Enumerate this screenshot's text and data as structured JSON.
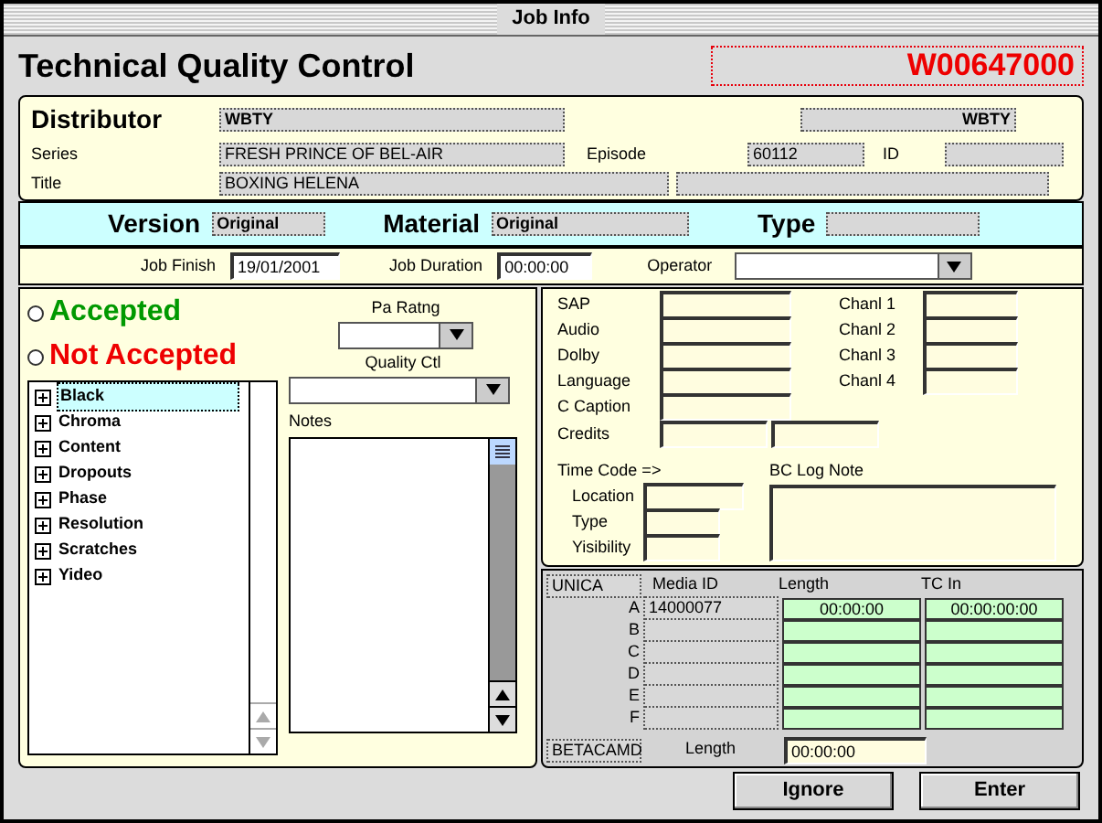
{
  "window": {
    "title": "Job Info"
  },
  "header": {
    "heading": "Technical Quality Control",
    "job_number": "W00647000"
  },
  "distributor": {
    "label": "Distributor",
    "value": "WBTY",
    "value_2": "WBTY"
  },
  "series": {
    "label": "Series",
    "value": "FRESH PRINCE OF BEL-AIR"
  },
  "episode": {
    "label": "Episode",
    "value": "60112"
  },
  "id": {
    "label": "ID"
  },
  "title_row": {
    "label": "Title",
    "value": "BOXING HELENA"
  },
  "version": {
    "label": "Version",
    "value": "Original"
  },
  "material": {
    "label": "Material",
    "value": "Original"
  },
  "type": {
    "label": "Type"
  },
  "job_finish": {
    "label": "Job Finish",
    "value": "19/01/2001"
  },
  "job_duration": {
    "label": "Job Duration",
    "value": "00:00:00"
  },
  "operator": {
    "label": "Operator"
  },
  "acceptance": [
    {
      "label": "Accepted",
      "selected": false,
      "color": "#009900"
    },
    {
      "label": "Not Accepted",
      "selected": false,
      "color": "#ee0000"
    }
  ],
  "pa_rating": {
    "label": "Pa Ratng"
  },
  "quality_ctl": {
    "label": "Quality Ctl"
  },
  "notes": {
    "label": "Notes"
  },
  "tree": [
    {
      "label": "Black",
      "selected": true,
      "expanded": false
    },
    {
      "label": "Chroma",
      "selected": false,
      "expanded": false
    },
    {
      "label": "Content",
      "selected": false,
      "expanded": false
    },
    {
      "label": "Dropouts",
      "selected": false,
      "expanded": false
    },
    {
      "label": "Phase",
      "selected": false,
      "expanded": false
    },
    {
      "label": "Resolution",
      "selected": false,
      "expanded": false
    },
    {
      "label": "Scratches",
      "selected": false,
      "expanded": false
    },
    {
      "label": "Yideo",
      "selected": false,
      "expanded": false
    }
  ],
  "audio_fields": [
    {
      "label": "SAP"
    },
    {
      "label": "Audio"
    },
    {
      "label": "Dolby"
    },
    {
      "label": "Language"
    },
    {
      "label": "C Caption"
    }
  ],
  "channels": [
    {
      "label": "Chanl 1"
    },
    {
      "label": "Chanl 2"
    },
    {
      "label": "Chanl 3"
    },
    {
      "label": "Chanl 4"
    }
  ],
  "credits": {
    "label": "Credits"
  },
  "time_code": {
    "label": "Time Code =>",
    "fields": [
      {
        "label": "Location"
      },
      {
        "label": "Type"
      },
      {
        "label": "Yisibility"
      }
    ]
  },
  "bc_log_note": {
    "label": "BC Log Note"
  },
  "unica": {
    "label": "UNICA",
    "columns": [
      "Media ID",
      "Length",
      "TC In"
    ],
    "rows": [
      {
        "letter": "A",
        "media_id": "14000077",
        "length": "00:00:00",
        "tc_in": "00:00:00:00"
      },
      {
        "letter": "B"
      },
      {
        "letter": "C"
      },
      {
        "letter": "D"
      },
      {
        "letter": "E"
      },
      {
        "letter": "F"
      }
    ]
  },
  "betacam": {
    "label": "BETACAMD",
    "length_label": "Length",
    "length_value": "00:00:00"
  },
  "buttons": [
    "Ignore",
    "Enter"
  ]
}
